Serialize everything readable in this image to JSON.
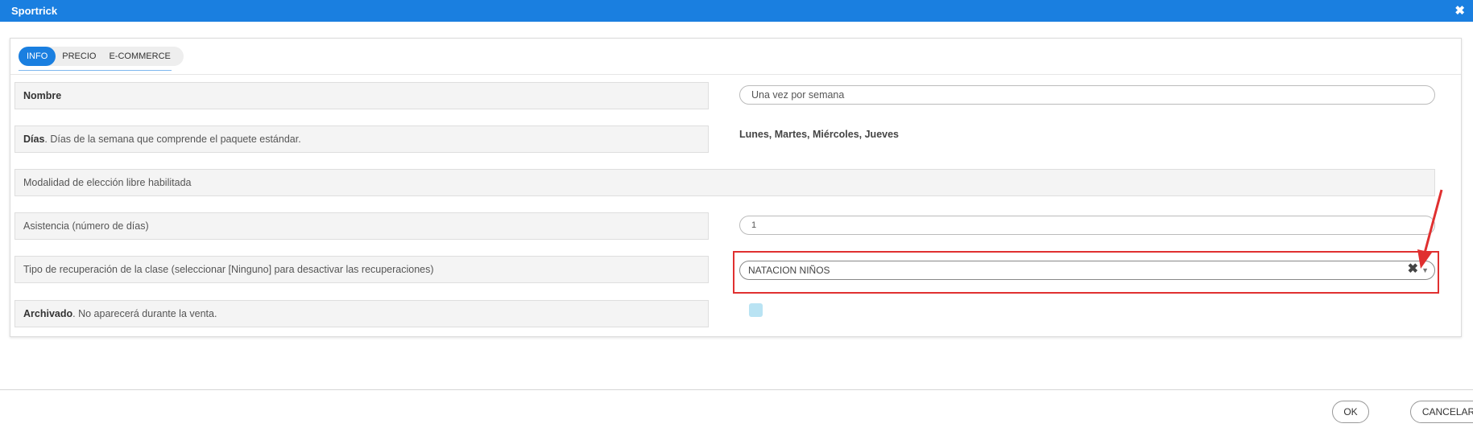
{
  "window": {
    "title": "Sportrick",
    "close_glyph": "✖"
  },
  "tabs": [
    {
      "label": "INFO",
      "active": true
    },
    {
      "label": "PRECIO",
      "active": false
    },
    {
      "label": "E-COMMERCE",
      "active": false
    }
  ],
  "form": {
    "nombre": {
      "label_bold": "Nombre",
      "value": "Una vez por semana"
    },
    "dias": {
      "label_bold": "Días",
      "label_rest": ". Días de la semana que comprende el paquete estándar.",
      "value": "Lunes, Martes, Miércoles, Jueves"
    },
    "modalidad": {
      "label": "Modalidad de elección libre habilitada"
    },
    "asistencia": {
      "label": "Asistencia (número de días)",
      "value": "1"
    },
    "tipo_recuperacion": {
      "label": "Tipo de recuperación de la clase (seleccionar [Ninguno] para desactivar las recuperaciones)",
      "value": "NATACION NIÑOS",
      "clear_glyph": "✖",
      "caret_glyph": "▼"
    },
    "archivado": {
      "label_bold": "Archivado",
      "label_rest": ". No aparecerá durante la venta.",
      "checked": false
    }
  },
  "footer": {
    "ok_label": "OK",
    "cancel_label": "CANCELAR"
  },
  "colors": {
    "accent": "#1a7fe0",
    "annotation": "#e03030",
    "checkbox": "#b9e3f3"
  }
}
